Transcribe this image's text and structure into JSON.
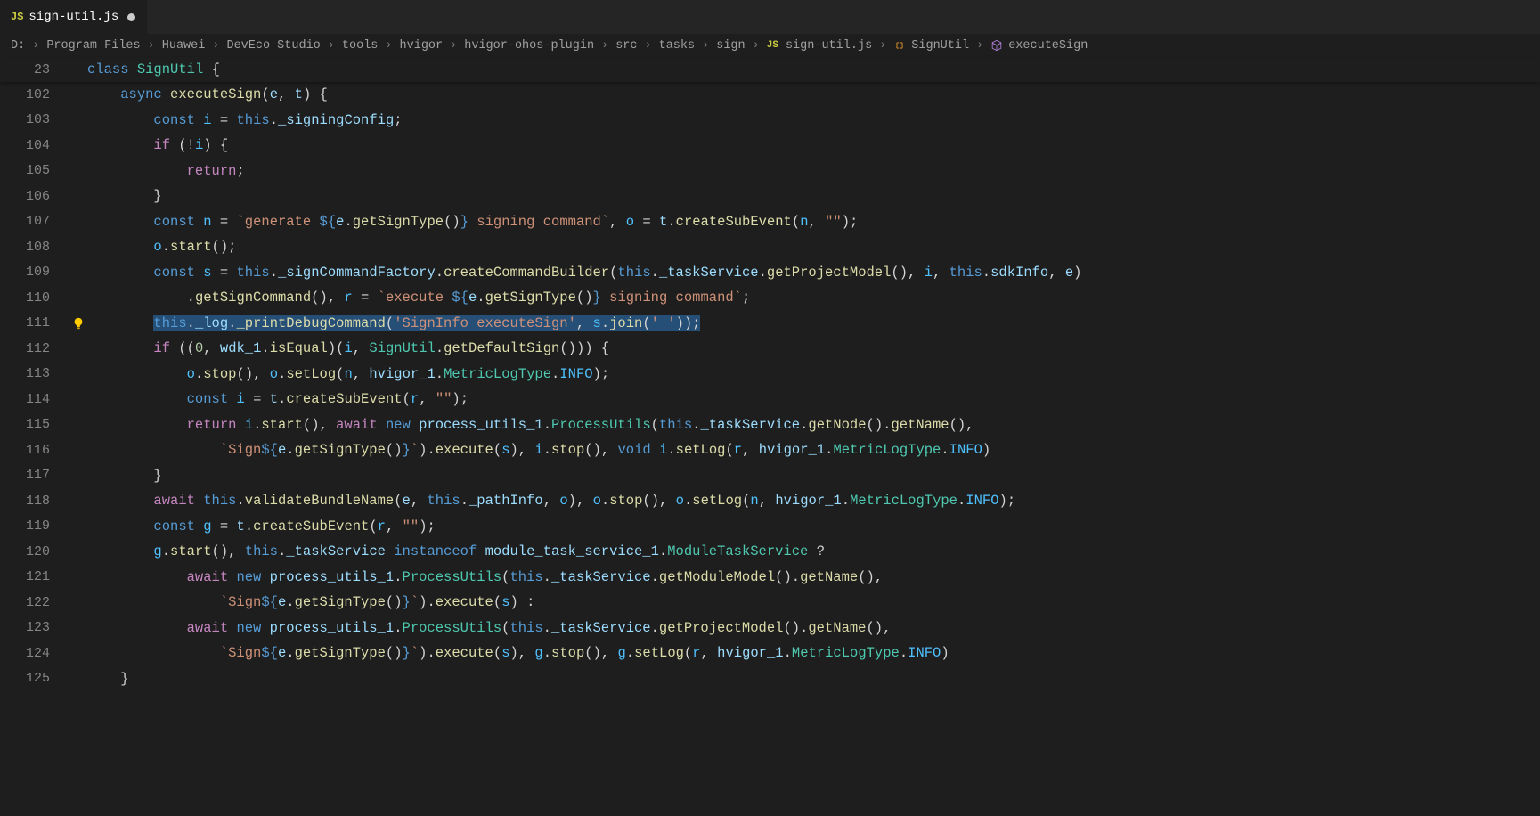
{
  "tab": {
    "icon_label": "JS",
    "filename": "sign-util.js",
    "dirty": true
  },
  "breadcrumbs": {
    "parts": [
      "D:",
      "Program Files",
      "Huawei",
      "DevEco Studio",
      "tools",
      "hvigor",
      "hvigor-ohos-plugin",
      "src",
      "tasks",
      "sign"
    ],
    "file_icon": "JS",
    "file": "sign-util.js",
    "symbols": [
      {
        "icon": "class",
        "label": "SignUtil"
      },
      {
        "icon": "method",
        "label": "executeSign"
      }
    ]
  },
  "sticky": {
    "line_no": "23",
    "tokens_html": "<span class='kw'>class</span> <span class='cls'>SignUtil</span> <span class='pun'>{</span>"
  },
  "lightbulb_line": "111",
  "lines": [
    {
      "n": "102",
      "t": "    <span class='kw'>async</span> <span class='fn'>executeSign</span><span class='pun'>(</span><span class='var'>e</span><span class='pun'>,</span> <span class='var'>t</span><span class='pun'>) {</span>"
    },
    {
      "n": "103",
      "t": "        <span class='kw'>const</span> <span class='cvar'>i</span> <span class='op'>=</span> <span class='this'>this</span><span class='pun'>.</span><span class='prop'>_signingConfig</span><span class='pun'>;</span>"
    },
    {
      "n": "104",
      "t": "        <span class='kw2'>if</span> <span class='pun'>(</span><span class='op'>!</span><span class='cvar'>i</span><span class='pun'>) {</span>"
    },
    {
      "n": "105",
      "t": "            <span class='kw2'>return</span><span class='pun'>;</span>"
    },
    {
      "n": "106",
      "t": "        <span class='pun'>}</span>"
    },
    {
      "n": "107",
      "t": "        <span class='kw'>const</span> <span class='cvar'>n</span> <span class='op'>=</span> <span class='str'>`generate </span><span class='kw'>${</span><span class='var'>e</span><span class='pun'>.</span><span class='fn'>getSignType</span><span class='pun'>()</span><span class='kw'>}</span><span class='str'> signing command`</span><span class='pun'>,</span> <span class='cvar'>o</span> <span class='op'>=</span> <span class='var'>t</span><span class='pun'>.</span><span class='fn'>createSubEvent</span><span class='pun'>(</span><span class='cvar'>n</span><span class='pun'>,</span> <span class='str'>\"\"</span><span class='pun'>);</span>"
    },
    {
      "n": "108",
      "t": "        <span class='cvar'>o</span><span class='pun'>.</span><span class='fn'>start</span><span class='pun'>();</span>"
    },
    {
      "n": "109",
      "t": "        <span class='kw'>const</span> <span class='cvar'>s</span> <span class='op'>=</span> <span class='this'>this</span><span class='pun'>.</span><span class='prop'>_signCommandFactory</span><span class='pun'>.</span><span class='fn'>createCommandBuilder</span><span class='pun'>(</span><span class='this'>this</span><span class='pun'>.</span><span class='prop'>_taskService</span><span class='pun'>.</span><span class='fn'>getProjectModel</span><span class='pun'>(),</span> <span class='cvar'>i</span><span class='pun'>,</span> <span class='this'>this</span><span class='pun'>.</span><span class='prop'>sdkInfo</span><span class='pun'>,</span> <span class='var'>e</span><span class='pun'>)</span>"
    },
    {
      "n": "110",
      "t": "            <span class='pun'>.</span><span class='fn'>getSignCommand</span><span class='pun'>(),</span> <span class='cvar'>r</span> <span class='op'>=</span> <span class='str'>`execute </span><span class='kw'>${</span><span class='var'>e</span><span class='pun'>.</span><span class='fn'>getSignType</span><span class='pun'>()</span><span class='kw'>}</span><span class='str'> signing command`</span><span class='pun'>;</span>"
    },
    {
      "n": "111",
      "t": "        <span class='selected'><span class='this'>this</span><span class='pun'>.</span><span class='prop'>_log</span><span class='pun'>.</span><span class='fn'>_printDebugCommand</span><span class='pun'>(</span><span class='str'>'SignInfo executeSign'</span><span class='pun'>,</span> <span class='cvar'>s</span><span class='pun'>.</span><span class='fn'>join</span><span class='pun'>(</span><span class='str'>' '</span><span class='pun'>));</span></span>"
    },
    {
      "n": "112",
      "t": "        <span class='kw2'>if</span> <span class='pun'>((</span><span class='num'>0</span><span class='pun'>,</span> <span class='var'>wdk_1</span><span class='pun'>.</span><span class='fn'>isEqual</span><span class='pun'>)(</span><span class='cvar'>i</span><span class='pun'>,</span> <span class='cls'>SignUtil</span><span class='pun'>.</span><span class='fn'>getDefaultSign</span><span class='pun'>())) {</span>"
    },
    {
      "n": "113",
      "t": "            <span class='cvar'>o</span><span class='pun'>.</span><span class='fn'>stop</span><span class='pun'>(),</span> <span class='cvar'>o</span><span class='pun'>.</span><span class='fn'>setLog</span><span class='pun'>(</span><span class='cvar'>n</span><span class='pun'>,</span> <span class='var'>hvigor_1</span><span class='pun'>.</span><span class='cls'>MetricLogType</span><span class='pun'>.</span><span class='cvar'>INFO</span><span class='pun'>);</span>"
    },
    {
      "n": "114",
      "t": "            <span class='kw'>const</span> <span class='cvar'>i</span> <span class='op'>=</span> <span class='var'>t</span><span class='pun'>.</span><span class='fn'>createSubEvent</span><span class='pun'>(</span><span class='cvar'>r</span><span class='pun'>,</span> <span class='str'>\"\"</span><span class='pun'>);</span>"
    },
    {
      "n": "115",
      "t": "            <span class='kw2'>return</span> <span class='cvar'>i</span><span class='pun'>.</span><span class='fn'>start</span><span class='pun'>(),</span> <span class='kw2'>await</span> <span class='kw'>new</span> <span class='var'>process_utils_1</span><span class='pun'>.</span><span class='cls'>ProcessUtils</span><span class='pun'>(</span><span class='this'>this</span><span class='pun'>.</span><span class='prop'>_taskService</span><span class='pun'>.</span><span class='fn'>getNode</span><span class='pun'>().</span><span class='fn'>getName</span><span class='pun'>(),</span>"
    },
    {
      "n": "116",
      "t": "                <span class='str'>`Sign</span><span class='kw'>${</span><span class='var'>e</span><span class='pun'>.</span><span class='fn'>getSignType</span><span class='pun'>()</span><span class='kw'>}</span><span class='str'>`</span><span class='pun'>).</span><span class='fn'>execute</span><span class='pun'>(</span><span class='cvar'>s</span><span class='pun'>),</span> <span class='cvar'>i</span><span class='pun'>.</span><span class='fn'>stop</span><span class='pun'>(),</span> <span class='kw'>void</span> <span class='cvar'>i</span><span class='pun'>.</span><span class='fn'>setLog</span><span class='pun'>(</span><span class='cvar'>r</span><span class='pun'>,</span> <span class='var'>hvigor_1</span><span class='pun'>.</span><span class='cls'>MetricLogType</span><span class='pun'>.</span><span class='cvar'>INFO</span><span class='pun'>)</span>"
    },
    {
      "n": "117",
      "t": "        <span class='pun'>}</span>"
    },
    {
      "n": "118",
      "t": "        <span class='kw2'>await</span> <span class='this'>this</span><span class='pun'>.</span><span class='fn'>validateBundleName</span><span class='pun'>(</span><span class='var'>e</span><span class='pun'>,</span> <span class='this'>this</span><span class='pun'>.</span><span class='prop'>_pathInfo</span><span class='pun'>,</span> <span class='cvar'>o</span><span class='pun'>),</span> <span class='cvar'>o</span><span class='pun'>.</span><span class='fn'>stop</span><span class='pun'>(),</span> <span class='cvar'>o</span><span class='pun'>.</span><span class='fn'>setLog</span><span class='pun'>(</span><span class='cvar'>n</span><span class='pun'>,</span> <span class='var'>hvigor_1</span><span class='pun'>.</span><span class='cls'>MetricLogType</span><span class='pun'>.</span><span class='cvar'>INFO</span><span class='pun'>);</span>"
    },
    {
      "n": "119",
      "t": "        <span class='kw'>const</span> <span class='cvar'>g</span> <span class='op'>=</span> <span class='var'>t</span><span class='pun'>.</span><span class='fn'>createSubEvent</span><span class='pun'>(</span><span class='cvar'>r</span><span class='pun'>,</span> <span class='str'>\"\"</span><span class='pun'>);</span>"
    },
    {
      "n": "120",
      "t": "        <span class='cvar'>g</span><span class='pun'>.</span><span class='fn'>start</span><span class='pun'>(),</span> <span class='this'>this</span><span class='pun'>.</span><span class='prop'>_taskService</span> <span class='kw'>instanceof</span> <span class='var'>module_task_service_1</span><span class='pun'>.</span><span class='cls'>ModuleTaskService</span> <span class='op'>?</span>"
    },
    {
      "n": "121",
      "t": "            <span class='kw2'>await</span> <span class='kw'>new</span> <span class='var'>process_utils_1</span><span class='pun'>.</span><span class='cls'>ProcessUtils</span><span class='pun'>(</span><span class='this'>this</span><span class='pun'>.</span><span class='prop'>_taskService</span><span class='pun'>.</span><span class='fn'>getModuleModel</span><span class='pun'>().</span><span class='fn'>getName</span><span class='pun'>(),</span>"
    },
    {
      "n": "122",
      "t": "                <span class='str'>`Sign</span><span class='kw'>${</span><span class='var'>e</span><span class='pun'>.</span><span class='fn'>getSignType</span><span class='pun'>()</span><span class='kw'>}</span><span class='str'>`</span><span class='pun'>).</span><span class='fn'>execute</span><span class='pun'>(</span><span class='cvar'>s</span><span class='pun'>) </span><span class='op'>:</span>"
    },
    {
      "n": "123",
      "t": "            <span class='kw2'>await</span> <span class='kw'>new</span> <span class='var'>process_utils_1</span><span class='pun'>.</span><span class='cls'>ProcessUtils</span><span class='pun'>(</span><span class='this'>this</span><span class='pun'>.</span><span class='prop'>_taskService</span><span class='pun'>.</span><span class='fn'>getProjectModel</span><span class='pun'>().</span><span class='fn'>getName</span><span class='pun'>(),</span>"
    },
    {
      "n": "124",
      "t": "                <span class='str'>`Sign</span><span class='kw'>${</span><span class='var'>e</span><span class='pun'>.</span><span class='fn'>getSignType</span><span class='pun'>()</span><span class='kw'>}</span><span class='str'>`</span><span class='pun'>).</span><span class='fn'>execute</span><span class='pun'>(</span><span class='cvar'>s</span><span class='pun'>),</span> <span class='cvar'>g</span><span class='pun'>.</span><span class='fn'>stop</span><span class='pun'>(),</span> <span class='cvar'>g</span><span class='pun'>.</span><span class='fn'>setLog</span><span class='pun'>(</span><span class='cvar'>r</span><span class='pun'>,</span> <span class='var'>hvigor_1</span><span class='pun'>.</span><span class='cls'>MetricLogType</span><span class='pun'>.</span><span class='cvar'>INFO</span><span class='pun'>)</span>"
    },
    {
      "n": "125",
      "t": "    <span class='pun'>}</span>"
    }
  ]
}
